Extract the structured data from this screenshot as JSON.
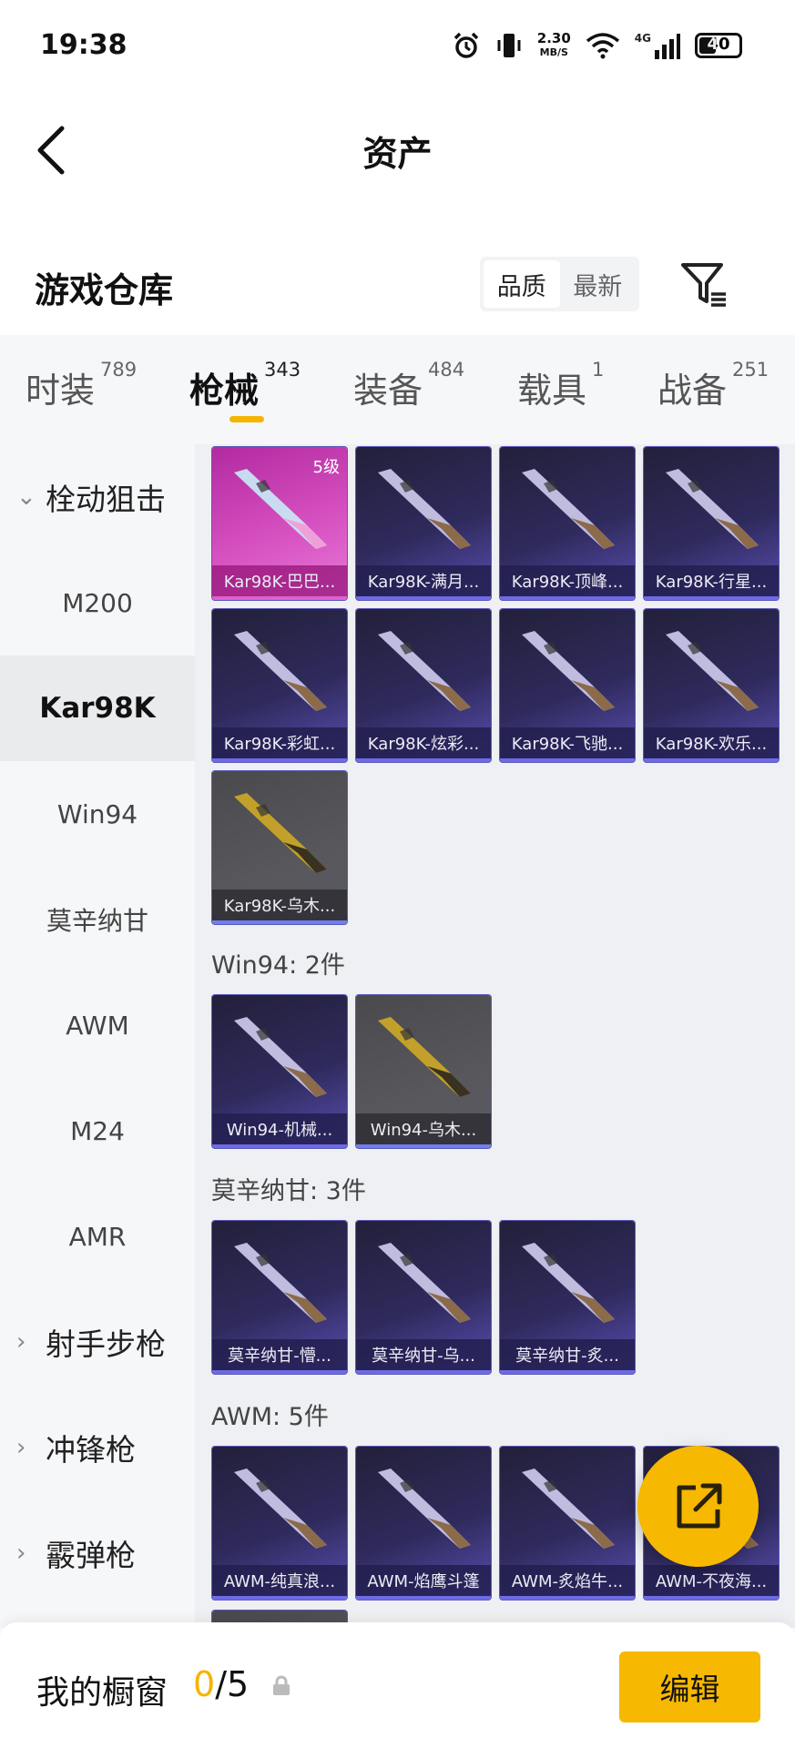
{
  "status": {
    "time": "19:38",
    "speed_value": "2.30",
    "speed_unit": "MB/S",
    "network": "4G",
    "battery": "40"
  },
  "header": {
    "title": "资产"
  },
  "warehouse": {
    "title": "游戏仓库",
    "sort_options": [
      "品质",
      "最新"
    ],
    "sort_active": "品质"
  },
  "tabs": [
    {
      "label": "时装",
      "count": "789"
    },
    {
      "label": "枪械",
      "count": "343"
    },
    {
      "label": "装备",
      "count": "484"
    },
    {
      "label": "载具",
      "count": "1"
    },
    {
      "label": "战备",
      "count": "251"
    }
  ],
  "active_tab": "枪械",
  "sidebar": {
    "category_open": "栓动狙击",
    "items": [
      "M200",
      "Kar98K",
      "Win94",
      "莫辛纳甘",
      "AWM",
      "M24",
      "AMR"
    ],
    "active_item": "Kar98K",
    "collapsed_categories": [
      "射手步枪",
      "冲锋枪",
      "霰弹枪"
    ]
  },
  "groups": {
    "kar98k_cards": [
      {
        "name": "Kar98K-巴巴...",
        "level": "5级",
        "style": "gold"
      },
      {
        "name": "Kar98K-满月...",
        "style": "purple"
      },
      {
        "name": "Kar98K-顶峰...",
        "style": "purple"
      },
      {
        "name": "Kar98K-行星...",
        "style": "purple"
      },
      {
        "name": "Kar98K-彩虹...",
        "style": "purple"
      },
      {
        "name": "Kar98K-炫彩...",
        "style": "purple"
      },
      {
        "name": "Kar98K-飞驰...",
        "style": "purple"
      },
      {
        "name": "Kar98K-欢乐...",
        "style": "purple"
      },
      {
        "name": "Kar98K-乌木...",
        "style": "grey"
      }
    ],
    "win94_label": "Win94: 2件",
    "win94_cards": [
      {
        "name": "Win94-机械...",
        "style": "purple"
      },
      {
        "name": "Win94-乌木...",
        "style": "grey"
      }
    ],
    "mosin_label": "莫辛纳甘: 3件",
    "mosin_cards": [
      {
        "name": "莫辛纳甘-懵...",
        "style": "purple"
      },
      {
        "name": "莫辛纳甘-乌...",
        "style": "purple"
      },
      {
        "name": "莫辛纳甘-炙...",
        "style": "purple"
      }
    ],
    "awm_label": "AWM: 5件",
    "awm_cards": [
      {
        "name": "AWM-纯真浪...",
        "style": "purple"
      },
      {
        "name": "AWM-焰鹰斗篷",
        "style": "purple"
      },
      {
        "name": "AWM-炙焰牛...",
        "style": "purple"
      },
      {
        "name": "AWM-不夜海...",
        "style": "purple"
      }
    ]
  },
  "bottom": {
    "showcase_label": "我的橱窗",
    "showcase_used": "0",
    "showcase_total": "/5",
    "edit_label": "编辑"
  },
  "colors": {
    "accent": "#f6b800",
    "card_purple": "#2f2a5c",
    "card_gold": "#d650c0",
    "card_grey": "#57575c"
  }
}
